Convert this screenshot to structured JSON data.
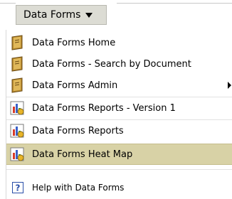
{
  "menubar": {
    "trigger_label": "Data Forms"
  },
  "menu": {
    "items": [
      {
        "label": "Data Forms Home",
        "icon": "book-icon"
      },
      {
        "label": "Data Forms - Search by Document",
        "icon": "book-icon"
      },
      {
        "label": "Data Forms Admin",
        "icon": "book-icon",
        "has_submenu": true
      },
      {
        "label": "Data Forms Reports - Version 1",
        "icon": "report-chart-icon"
      },
      {
        "label": "Data Forms Reports",
        "icon": "report-chart-icon"
      },
      {
        "label": "Data Forms Heat Map",
        "icon": "report-chart-icon",
        "highlighted": true
      },
      {
        "label": "Help with Data Forms",
        "icon": "help-icon"
      }
    ]
  },
  "colors": {
    "trigger_background": "#dcdcd4",
    "highlight_background": "#d8d2a6"
  }
}
